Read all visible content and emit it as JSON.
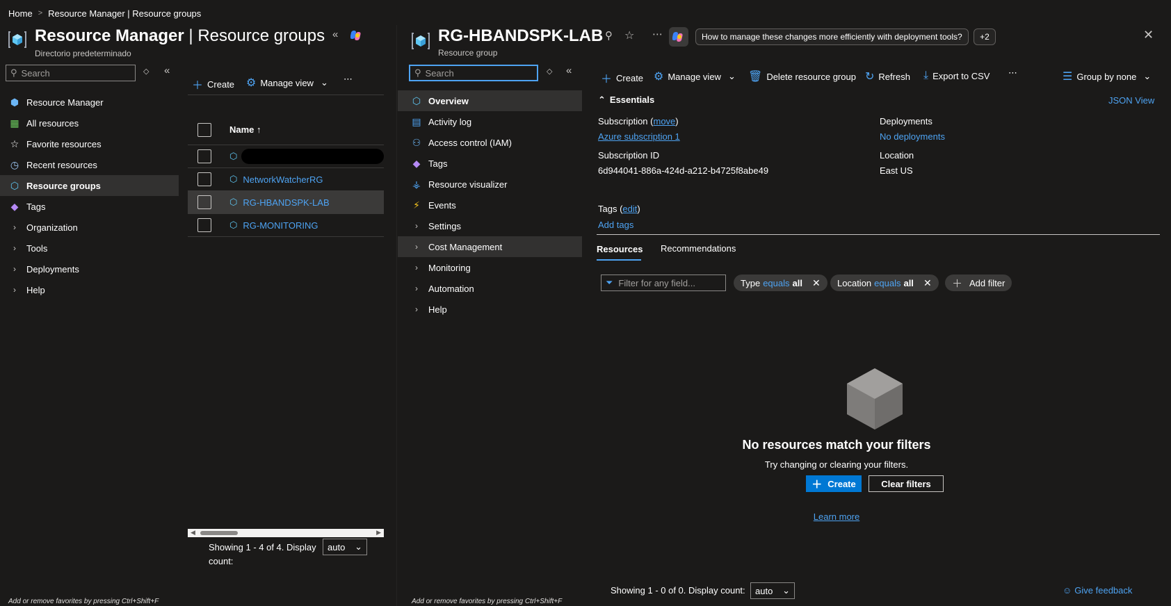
{
  "breadcrumb": {
    "home": "Home",
    "current": "Resource Manager | Resource groups"
  },
  "left": {
    "title_main": "Resource Manager",
    "title_sep": " | ",
    "title_sub": "Resource groups",
    "subtitle": "Directorio predeterminado",
    "search_placeholder": "Search",
    "nav": [
      {
        "label": "Resource Manager",
        "icon": "resource-manager-icon"
      },
      {
        "label": "All resources",
        "icon": "all-resources-icon"
      },
      {
        "label": "Favorite resources",
        "icon": "star-icon"
      },
      {
        "label": "Recent resources",
        "icon": "clock-icon"
      },
      {
        "label": "Resource groups",
        "icon": "resource-group-icon",
        "active": true
      },
      {
        "label": "Tags",
        "icon": "tag-icon"
      },
      {
        "label": "Organization",
        "expandable": true
      },
      {
        "label": "Tools",
        "expandable": true
      },
      {
        "label": "Deployments",
        "expandable": true
      },
      {
        "label": "Help",
        "expandable": true
      }
    ],
    "toolbar": {
      "create": "Create",
      "manage_view": "Manage view"
    },
    "grid": {
      "header_name": "Name ↑",
      "rows": [
        {
          "name": "",
          "redacted": true
        },
        {
          "name": "NetworkWatcherRG"
        },
        {
          "name": "RG-HBANDSPK-LAB",
          "selected": true
        },
        {
          "name": "RG-MONITORING"
        }
      ]
    },
    "paging": {
      "text": "Showing 1 - 4 of 4. Display count:",
      "display_count": "auto"
    },
    "footer_hint": "Add or remove favorites by pressing Ctrl+Shift+F"
  },
  "right": {
    "title": "RG-HBANDSPK-LAB",
    "subtitle": "Resource group",
    "copilot_prompt": "How to manage these changes more efficiently with deployment tools?",
    "copilot_more": "+2",
    "search_placeholder": "Search",
    "nav": [
      {
        "label": "Overview",
        "icon": "overview-icon",
        "active": true
      },
      {
        "label": "Activity log",
        "icon": "activity-log-icon"
      },
      {
        "label": "Access control (IAM)",
        "icon": "iam-icon"
      },
      {
        "label": "Tags",
        "icon": "tag-icon"
      },
      {
        "label": "Resource visualizer",
        "icon": "visualizer-icon"
      },
      {
        "label": "Events",
        "icon": "lightning-icon"
      },
      {
        "label": "Settings",
        "expandable": true
      },
      {
        "label": "Cost Management",
        "expandable": true,
        "hover": true
      },
      {
        "label": "Monitoring",
        "expandable": true
      },
      {
        "label": "Automation",
        "expandable": true
      },
      {
        "label": "Help",
        "expandable": true
      }
    ],
    "toolbar": {
      "create": "Create",
      "manage_view": "Manage view",
      "delete": "Delete resource group",
      "refresh": "Refresh",
      "export": "Export to CSV",
      "group_by": "Group by none"
    },
    "essentials": {
      "title": "Essentials",
      "json_view": "JSON View",
      "subscription_label": "Subscription (",
      "subscription_move": "move",
      "subscription_label_end": ")",
      "subscription_value": "Azure subscription 1",
      "subscription_id_label": "Subscription ID",
      "subscription_id_value": "6d944041-886a-424d-a212-b4725f8abe49",
      "tags_label": "Tags (",
      "tags_edit": "edit",
      "tags_label_end": ")",
      "add_tags": "Add tags",
      "deployments_label": "Deployments",
      "deployments_value": "No deployments",
      "location_label": "Location",
      "location_value": "East US"
    },
    "tabs": [
      {
        "label": "Resources",
        "active": true
      },
      {
        "label": "Recommendations"
      }
    ],
    "filter_placeholder": "Filter for any field...",
    "filters": [
      {
        "field": "Type",
        "op": "equals",
        "value": "all"
      },
      {
        "field": "Location",
        "op": "equals",
        "value": "all"
      }
    ],
    "add_filter": "Add filter",
    "empty": {
      "title": "No resources match your filters",
      "subtitle": "Try changing or clearing your filters.",
      "create": "Create",
      "clear": "Clear filters",
      "learn_more": "Learn more"
    },
    "paging": {
      "text": "Showing 1 - 0 of 0. Display count:",
      "display_count": "auto"
    },
    "feedback": "Give feedback",
    "footer_hint": "Add or remove favorites by pressing Ctrl+Shift+F"
  },
  "colors": {
    "accent": "#4ea3f2",
    "primary_button": "#0078d4",
    "background": "#1b1a19",
    "selected": "#323130"
  }
}
